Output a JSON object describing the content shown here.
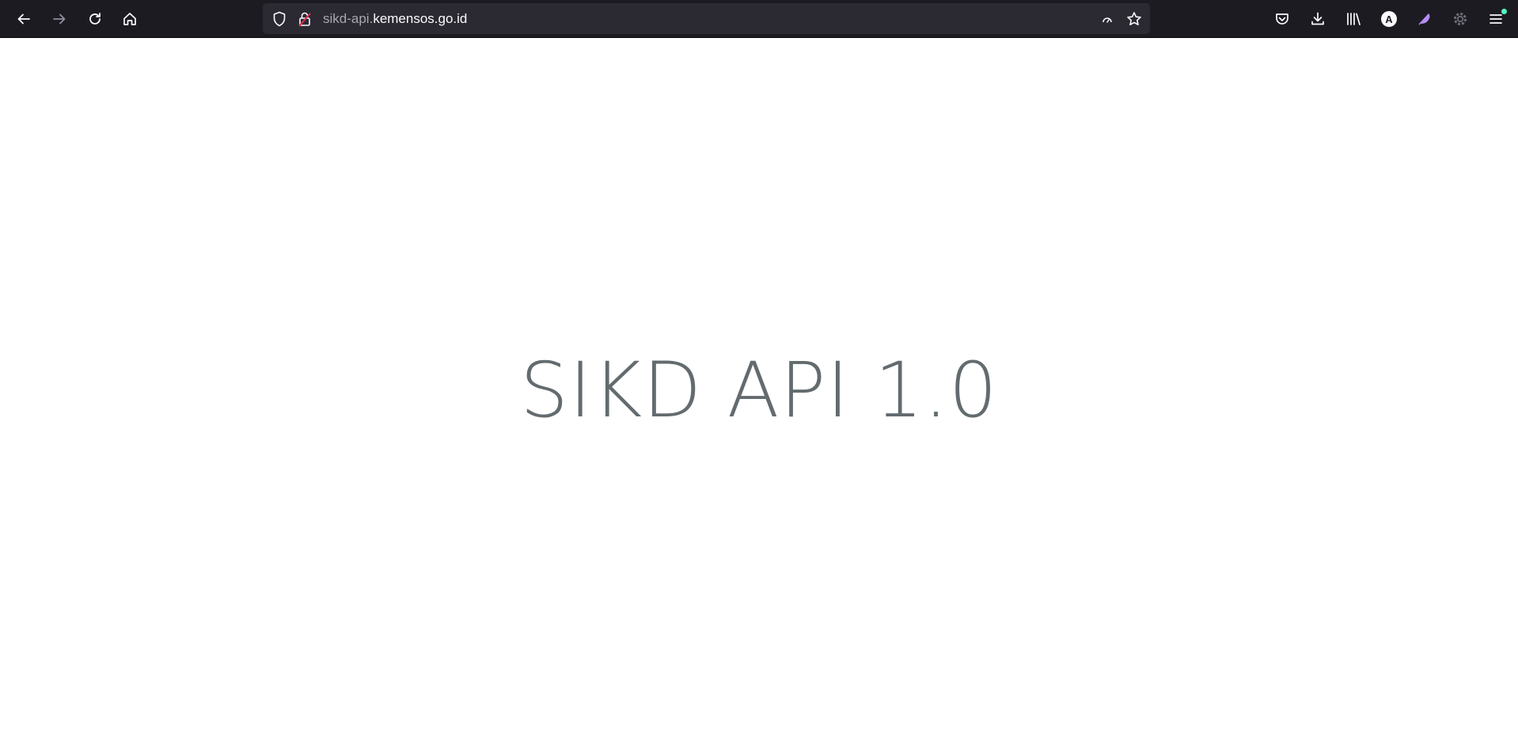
{
  "browser": {
    "url": {
      "prefix": "sikd-api.",
      "domain": "kemensos.go.id"
    },
    "colors": {
      "toolbar": "#1c1b22",
      "urlbar": "#2b2a33",
      "icon": "#fbfbfe",
      "icon_disabled": "#8f8f9d",
      "notification_dot": "#54ffbd",
      "extension_purple": "#b98cf5"
    },
    "icons": {
      "back": "arrow-left-icon",
      "forward": "arrow-right-icon",
      "reload": "reload-icon",
      "home": "home-icon",
      "tracking": "shield-icon",
      "connection": "insecure-lock-icon",
      "reader": "reader-view-icon",
      "bookmark": "star-icon",
      "pocket": "pocket-icon",
      "downloads": "download-icon",
      "library": "library-icon",
      "account": "account-avatar",
      "extension": "feather-extension-icon",
      "extension2": "gear-extension-icon",
      "menu": "hamburger-menu-icon"
    },
    "account_initial": "A"
  },
  "page": {
    "heading": "SIKD API 1.0",
    "text_color": "#636b6f",
    "background": "#ffffff"
  }
}
